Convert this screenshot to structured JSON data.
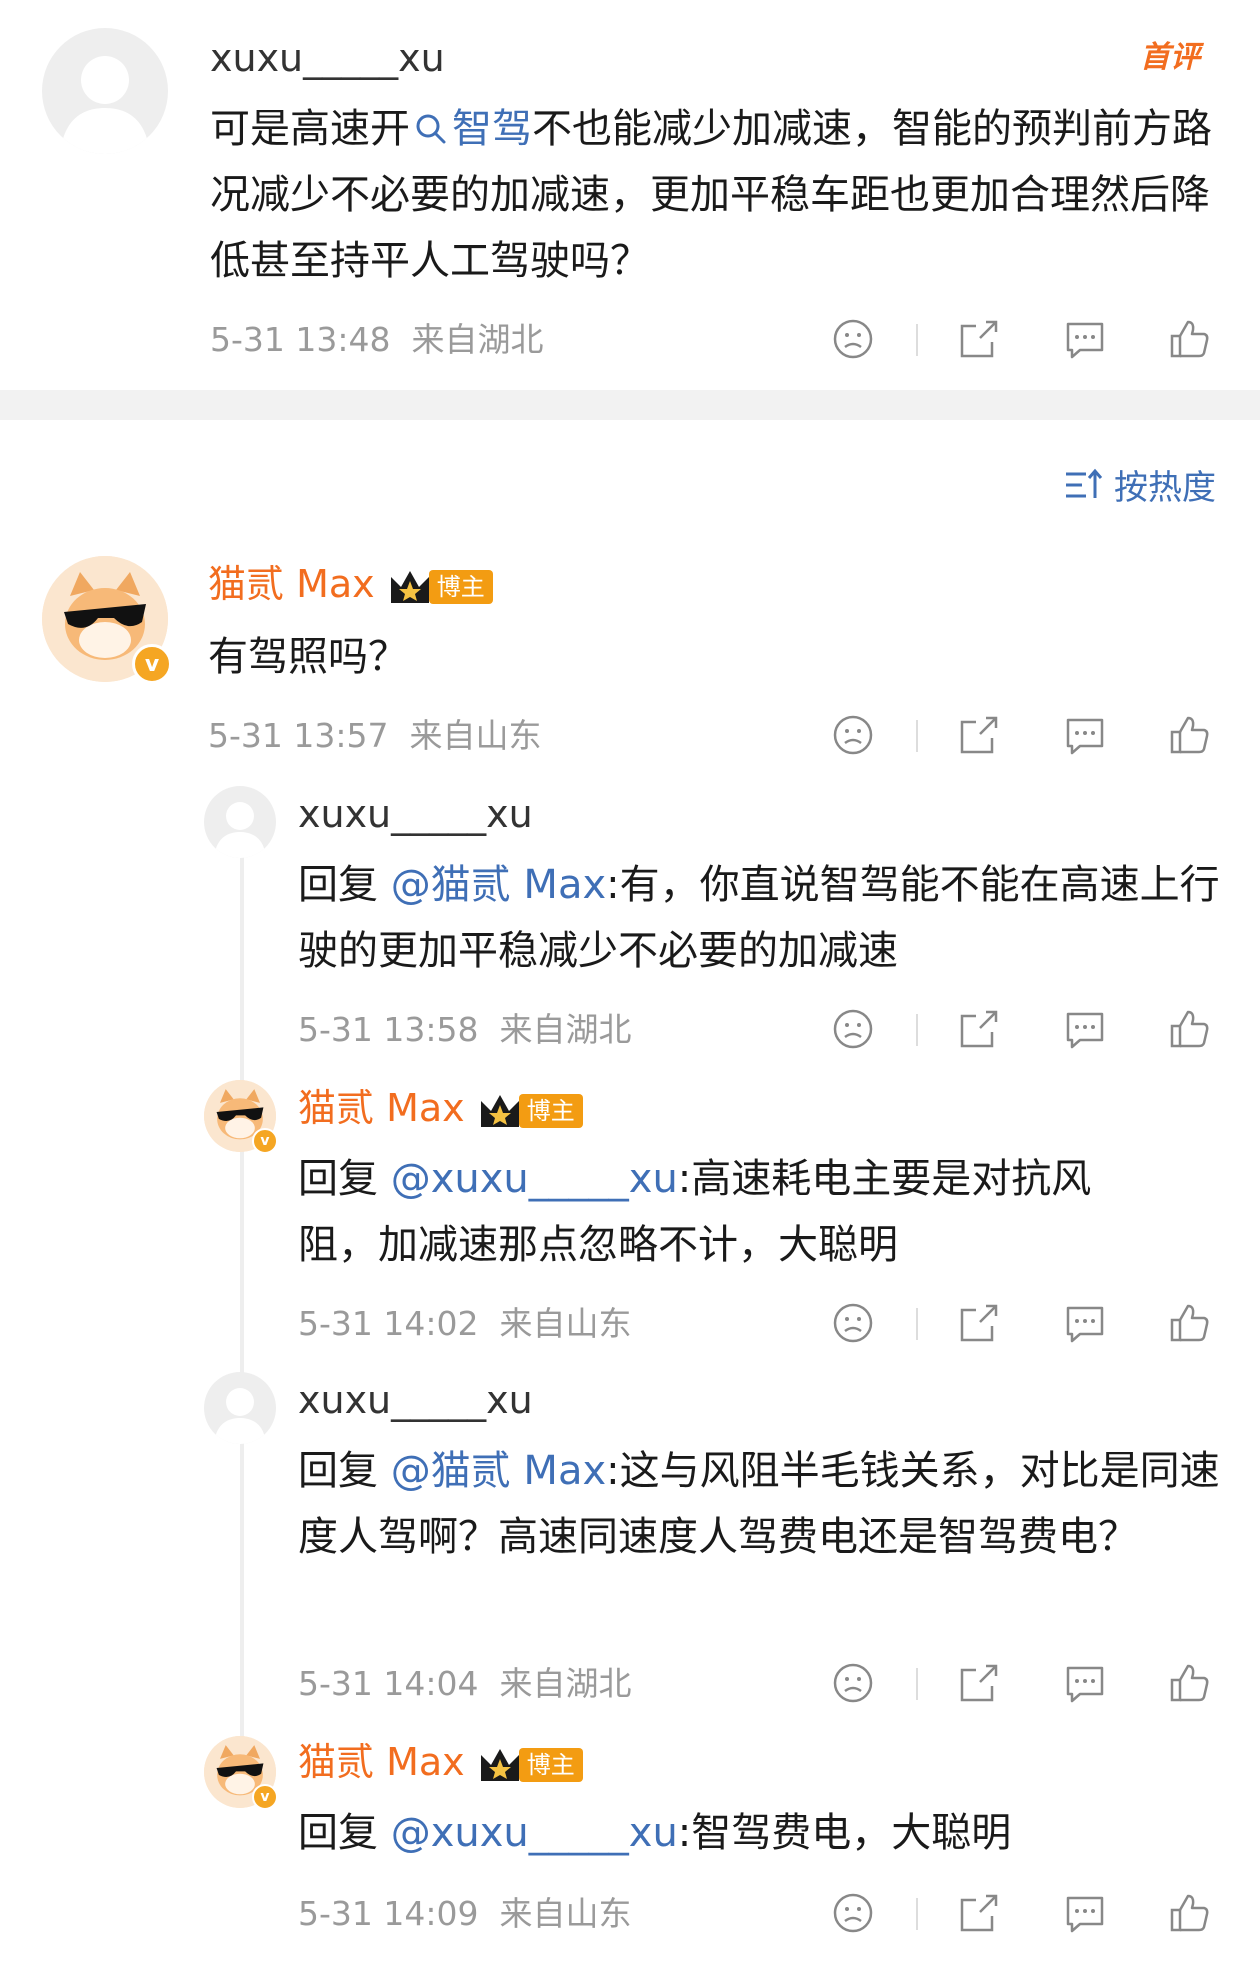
{
  "comments": [
    {
      "user": "xuxu_____xu",
      "badge": "首评",
      "text_pre": "可是高速开",
      "topic_link": "智驾",
      "text_post": "不也能减少加减速，智能的预判前方路况减少不必要的加减速，更加平稳车距也更加合理然后降低甚至持平人工驾驶吗？",
      "time": "5-31 13:48",
      "location": "来自湖北"
    }
  ],
  "sort_label": "按热度",
  "main_comment": {
    "user": "猫贰 Max",
    "tag": "博主",
    "text": "有驾照吗？",
    "time": "5-31 13:57",
    "location": "来自山东"
  },
  "replies": [
    {
      "user": "xuxu_____xu",
      "reply_prefix": "回复",
      "mention": "@猫贰 Max",
      "text": ":有，你直说智驾能不能在高速上行驶的更加平稳减少不必要的加减速",
      "time": "5-31 13:58",
      "location": "来自湖北"
    },
    {
      "user": "猫贰 Max",
      "tag": "博主",
      "reply_prefix": "回复",
      "mention": "@xuxu_____xu",
      "text": ":高速耗电主要是对抗风阻，加减速那点忽略不计，大聪明",
      "time": "5-31 14:02",
      "location": "来自山东"
    },
    {
      "user": "xuxu_____xu",
      "reply_prefix": "回复",
      "mention": "@猫贰 Max",
      "text": ":这与风阻半毛钱关系，对比是同速度人驾啊？高速同速度人驾费电还是智驾费电？",
      "time": "5-31 14:04",
      "location": "来自湖北"
    },
    {
      "user": "猫贰 Max",
      "tag": "博主",
      "reply_prefix": "回复",
      "mention": "@xuxu_____xu",
      "text": ":智驾费电，大聪明",
      "time": "5-31 14:09",
      "location": "来自山东"
    }
  ]
}
